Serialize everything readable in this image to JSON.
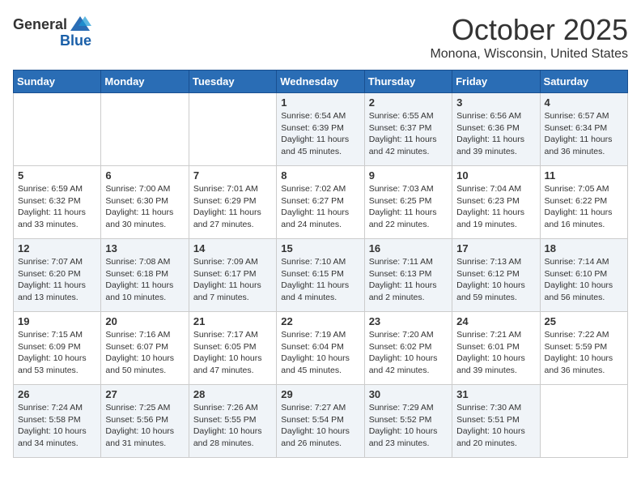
{
  "header": {
    "logo_general": "General",
    "logo_blue": "Blue",
    "month": "October 2025",
    "location": "Monona, Wisconsin, United States"
  },
  "weekdays": [
    "Sunday",
    "Monday",
    "Tuesday",
    "Wednesday",
    "Thursday",
    "Friday",
    "Saturday"
  ],
  "weeks": [
    [
      {
        "day": "",
        "sunrise": "",
        "sunset": "",
        "daylight": ""
      },
      {
        "day": "",
        "sunrise": "",
        "sunset": "",
        "daylight": ""
      },
      {
        "day": "",
        "sunrise": "",
        "sunset": "",
        "daylight": ""
      },
      {
        "day": "1",
        "sunrise": "Sunrise: 6:54 AM",
        "sunset": "Sunset: 6:39 PM",
        "daylight": "Daylight: 11 hours and 45 minutes."
      },
      {
        "day": "2",
        "sunrise": "Sunrise: 6:55 AM",
        "sunset": "Sunset: 6:37 PM",
        "daylight": "Daylight: 11 hours and 42 minutes."
      },
      {
        "day": "3",
        "sunrise": "Sunrise: 6:56 AM",
        "sunset": "Sunset: 6:36 PM",
        "daylight": "Daylight: 11 hours and 39 minutes."
      },
      {
        "day": "4",
        "sunrise": "Sunrise: 6:57 AM",
        "sunset": "Sunset: 6:34 PM",
        "daylight": "Daylight: 11 hours and 36 minutes."
      }
    ],
    [
      {
        "day": "5",
        "sunrise": "Sunrise: 6:59 AM",
        "sunset": "Sunset: 6:32 PM",
        "daylight": "Daylight: 11 hours and 33 minutes."
      },
      {
        "day": "6",
        "sunrise": "Sunrise: 7:00 AM",
        "sunset": "Sunset: 6:30 PM",
        "daylight": "Daylight: 11 hours and 30 minutes."
      },
      {
        "day": "7",
        "sunrise": "Sunrise: 7:01 AM",
        "sunset": "Sunset: 6:29 PM",
        "daylight": "Daylight: 11 hours and 27 minutes."
      },
      {
        "day": "8",
        "sunrise": "Sunrise: 7:02 AM",
        "sunset": "Sunset: 6:27 PM",
        "daylight": "Daylight: 11 hours and 24 minutes."
      },
      {
        "day": "9",
        "sunrise": "Sunrise: 7:03 AM",
        "sunset": "Sunset: 6:25 PM",
        "daylight": "Daylight: 11 hours and 22 minutes."
      },
      {
        "day": "10",
        "sunrise": "Sunrise: 7:04 AM",
        "sunset": "Sunset: 6:23 PM",
        "daylight": "Daylight: 11 hours and 19 minutes."
      },
      {
        "day": "11",
        "sunrise": "Sunrise: 7:05 AM",
        "sunset": "Sunset: 6:22 PM",
        "daylight": "Daylight: 11 hours and 16 minutes."
      }
    ],
    [
      {
        "day": "12",
        "sunrise": "Sunrise: 7:07 AM",
        "sunset": "Sunset: 6:20 PM",
        "daylight": "Daylight: 11 hours and 13 minutes."
      },
      {
        "day": "13",
        "sunrise": "Sunrise: 7:08 AM",
        "sunset": "Sunset: 6:18 PM",
        "daylight": "Daylight: 11 hours and 10 minutes."
      },
      {
        "day": "14",
        "sunrise": "Sunrise: 7:09 AM",
        "sunset": "Sunset: 6:17 PM",
        "daylight": "Daylight: 11 hours and 7 minutes."
      },
      {
        "day": "15",
        "sunrise": "Sunrise: 7:10 AM",
        "sunset": "Sunset: 6:15 PM",
        "daylight": "Daylight: 11 hours and 4 minutes."
      },
      {
        "day": "16",
        "sunrise": "Sunrise: 7:11 AM",
        "sunset": "Sunset: 6:13 PM",
        "daylight": "Daylight: 11 hours and 2 minutes."
      },
      {
        "day": "17",
        "sunrise": "Sunrise: 7:13 AM",
        "sunset": "Sunset: 6:12 PM",
        "daylight": "Daylight: 10 hours and 59 minutes."
      },
      {
        "day": "18",
        "sunrise": "Sunrise: 7:14 AM",
        "sunset": "Sunset: 6:10 PM",
        "daylight": "Daylight: 10 hours and 56 minutes."
      }
    ],
    [
      {
        "day": "19",
        "sunrise": "Sunrise: 7:15 AM",
        "sunset": "Sunset: 6:09 PM",
        "daylight": "Daylight: 10 hours and 53 minutes."
      },
      {
        "day": "20",
        "sunrise": "Sunrise: 7:16 AM",
        "sunset": "Sunset: 6:07 PM",
        "daylight": "Daylight: 10 hours and 50 minutes."
      },
      {
        "day": "21",
        "sunrise": "Sunrise: 7:17 AM",
        "sunset": "Sunset: 6:05 PM",
        "daylight": "Daylight: 10 hours and 47 minutes."
      },
      {
        "day": "22",
        "sunrise": "Sunrise: 7:19 AM",
        "sunset": "Sunset: 6:04 PM",
        "daylight": "Daylight: 10 hours and 45 minutes."
      },
      {
        "day": "23",
        "sunrise": "Sunrise: 7:20 AM",
        "sunset": "Sunset: 6:02 PM",
        "daylight": "Daylight: 10 hours and 42 minutes."
      },
      {
        "day": "24",
        "sunrise": "Sunrise: 7:21 AM",
        "sunset": "Sunset: 6:01 PM",
        "daylight": "Daylight: 10 hours and 39 minutes."
      },
      {
        "day": "25",
        "sunrise": "Sunrise: 7:22 AM",
        "sunset": "Sunset: 5:59 PM",
        "daylight": "Daylight: 10 hours and 36 minutes."
      }
    ],
    [
      {
        "day": "26",
        "sunrise": "Sunrise: 7:24 AM",
        "sunset": "Sunset: 5:58 PM",
        "daylight": "Daylight: 10 hours and 34 minutes."
      },
      {
        "day": "27",
        "sunrise": "Sunrise: 7:25 AM",
        "sunset": "Sunset: 5:56 PM",
        "daylight": "Daylight: 10 hours and 31 minutes."
      },
      {
        "day": "28",
        "sunrise": "Sunrise: 7:26 AM",
        "sunset": "Sunset: 5:55 PM",
        "daylight": "Daylight: 10 hours and 28 minutes."
      },
      {
        "day": "29",
        "sunrise": "Sunrise: 7:27 AM",
        "sunset": "Sunset: 5:54 PM",
        "daylight": "Daylight: 10 hours and 26 minutes."
      },
      {
        "day": "30",
        "sunrise": "Sunrise: 7:29 AM",
        "sunset": "Sunset: 5:52 PM",
        "daylight": "Daylight: 10 hours and 23 minutes."
      },
      {
        "day": "31",
        "sunrise": "Sunrise: 7:30 AM",
        "sunset": "Sunset: 5:51 PM",
        "daylight": "Daylight: 10 hours and 20 minutes."
      },
      {
        "day": "",
        "sunrise": "",
        "sunset": "",
        "daylight": ""
      }
    ]
  ]
}
